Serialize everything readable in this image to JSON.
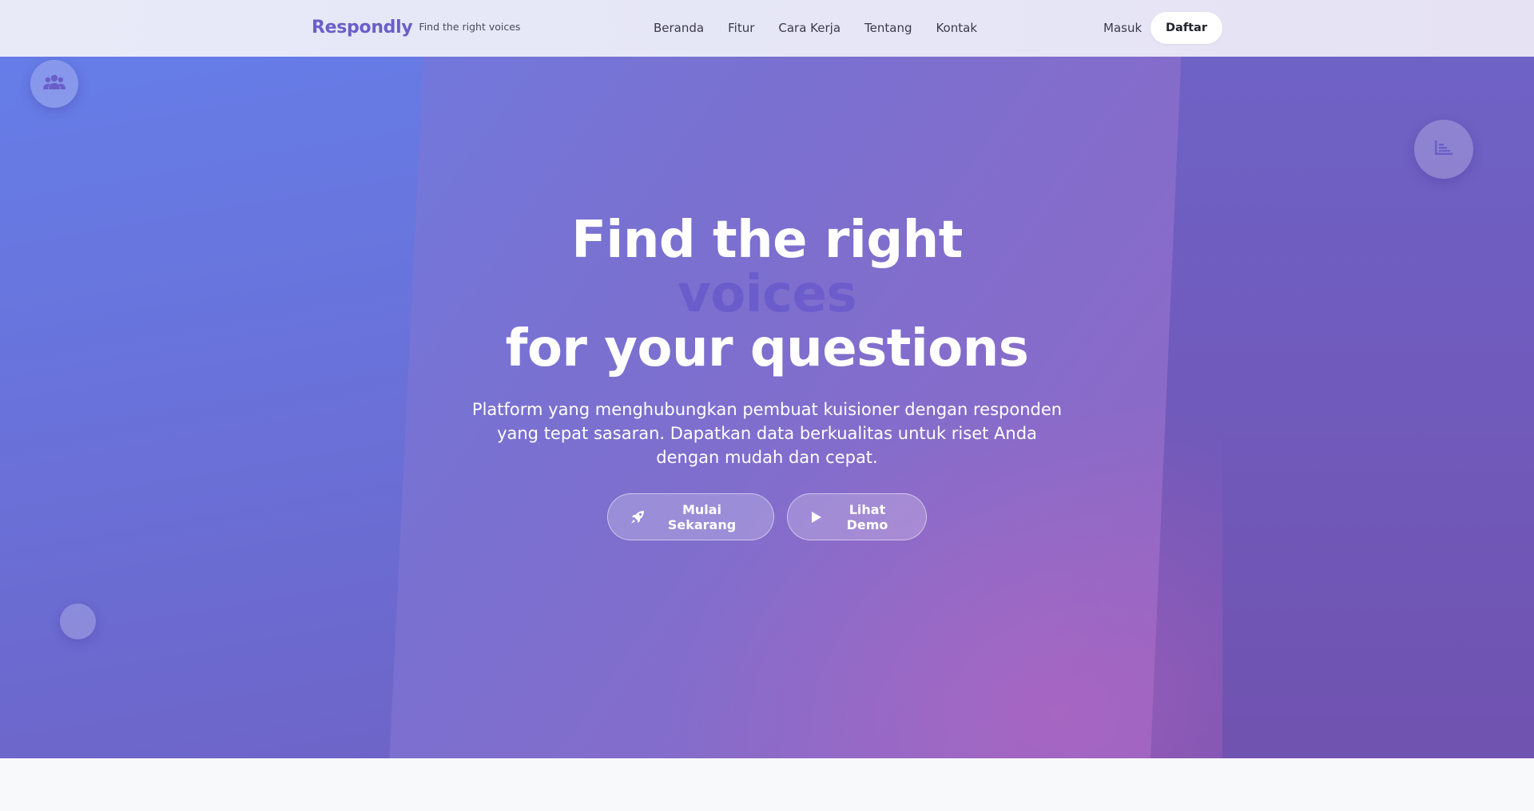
{
  "navbar": {
    "brand_name": "Respondly",
    "brand_tagline": "Find the right voices",
    "links": [
      "Beranda",
      "Fitur",
      "Cara Kerja",
      "Tentang",
      "Kontak"
    ],
    "login_label": "Masuk",
    "signup_label": "Daftar"
  },
  "hero": {
    "title_line1": "Find the right",
    "title_accent": "voices",
    "title_line3": "for your questions",
    "subtitle": "Platform yang menghubungkan pembuat kuisioner dengan responden yang tepat sasaran. Dapatkan data berkualitas untuk riset Anda dengan mudah dan cepat.",
    "primary_button": "Mulai Sekarang",
    "demo_button": "Lihat Demo"
  },
  "icons": {
    "users": "users-icon",
    "chart": "chart-icon",
    "rocket": "rocket-icon",
    "play": "play-icon"
  },
  "colors": {
    "brand": "#6a5fc8",
    "accent_word": "#6a5bcc",
    "hero_start": "#6a80e8",
    "hero_end": "#9a5fbc"
  }
}
